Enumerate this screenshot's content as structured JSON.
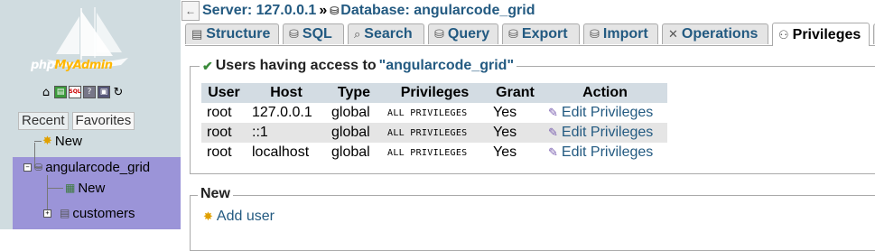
{
  "nav": {
    "logo": {
      "part1": "php",
      "part2": "MyAdmin"
    },
    "quick_icons": [
      "home-icon",
      "sql-query-icon",
      "sql-icon",
      "docs-icon",
      "docs-alt-icon",
      "reload-icon"
    ],
    "tabs": [
      "Recent",
      "Favorites"
    ],
    "tree": {
      "new_label": "New",
      "database": "angularcode_grid",
      "db_new_label": "New",
      "table": "customers"
    }
  },
  "breadcrumb": {
    "server": "Server: 127.0.0.1",
    "separator": "»",
    "database": "Database: angularcode_grid"
  },
  "tabs": [
    {
      "label": "Structure",
      "icon": "structure-icon"
    },
    {
      "label": "SQL",
      "icon": "sql-icon"
    },
    {
      "label": "Search",
      "icon": "search-icon"
    },
    {
      "label": "Query",
      "icon": "query-icon"
    },
    {
      "label": "Export",
      "icon": "export-icon"
    },
    {
      "label": "Import",
      "icon": "import-icon"
    },
    {
      "label": "Operations",
      "icon": "wrench-icon"
    },
    {
      "label": "Privileges",
      "icon": "privileges-icon",
      "active": true
    }
  ],
  "users_section": {
    "legend_prefix": "Users having access to",
    "legend_db": "\"angularcode_grid\"",
    "columns": [
      "User",
      "Host",
      "Type",
      "Privileges",
      "Grant",
      "Action"
    ],
    "rows": [
      {
        "user": "root",
        "host": "127.0.0.1",
        "type": "global",
        "privileges": "ALL PRIVILEGES",
        "grant": "Yes",
        "action": "Edit Privileges"
      },
      {
        "user": "root",
        "host": "::1",
        "type": "global",
        "privileges": "ALL PRIVILEGES",
        "grant": "Yes",
        "action": "Edit Privileges"
      },
      {
        "user": "root",
        "host": "localhost",
        "type": "global",
        "privileges": "ALL PRIVILEGES",
        "grant": "Yes",
        "action": "Edit Privileges"
      }
    ]
  },
  "new_section": {
    "legend": "New",
    "add_user": "Add user"
  },
  "colors": {
    "link": "#235a81",
    "nav_bg": "#d0dce0",
    "tree_highlight": "#9b94d8",
    "table_header": "#d3dce3",
    "row_even": "#e5e5e5"
  }
}
